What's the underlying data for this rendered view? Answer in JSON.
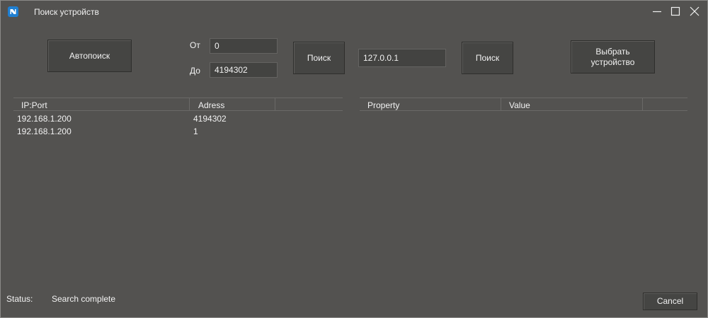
{
  "window": {
    "title": "Поиск устройств",
    "icon": "app-logo-icon"
  },
  "controls": {
    "autosearch_label": "Автопоиск",
    "from_label": "От",
    "from_value": "0",
    "to_label": "До",
    "to_value": "4194302",
    "search_range_label": "Поиск",
    "ip_value": "127.0.0.1",
    "search_ip_label": "Поиск",
    "select_device_label": "Выбрать\nустройство",
    "cancel_label": "Cancel"
  },
  "devices_table": {
    "columns": [
      "IP:Port",
      "Adress"
    ],
    "rows": [
      [
        "192.168.1.200",
        "4194302"
      ],
      [
        "192.168.1.200",
        "1"
      ]
    ]
  },
  "properties_table": {
    "columns": [
      "Property",
      "Value"
    ],
    "rows": []
  },
  "status": {
    "label": "Status:",
    "text": "Search complete"
  },
  "colors": {
    "background": "#535250",
    "button": "#454543",
    "text": "#f2f2f2",
    "logo": "#1f7fd1"
  }
}
